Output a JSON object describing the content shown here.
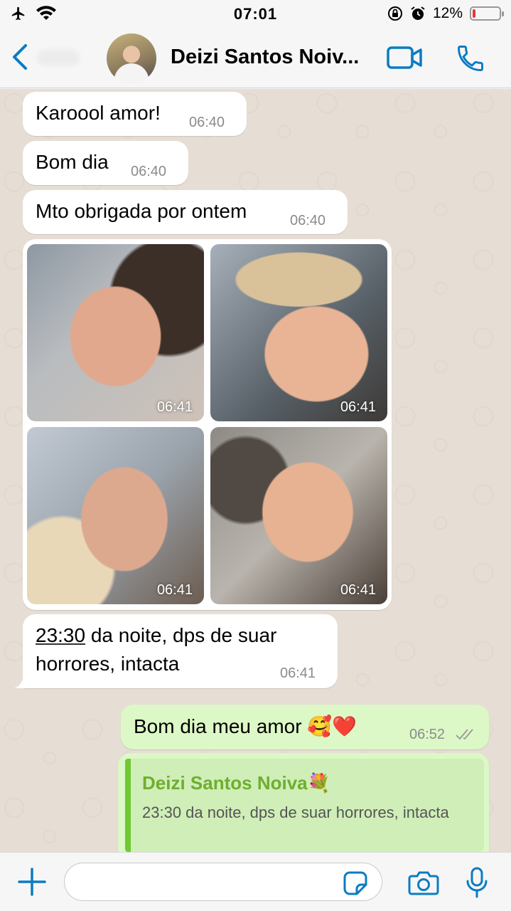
{
  "status_bar": {
    "time": "07:01",
    "battery": "12%",
    "battery_level": 0.12
  },
  "header": {
    "contact_name": "Deizi Santos Noiv..."
  },
  "messages": [
    {
      "text": "Karoool amor!",
      "time": "06:40"
    },
    {
      "text": "Bom dia",
      "time": "06:40"
    },
    {
      "text": "Mto obrigada por ontem",
      "time": "06:40"
    }
  ],
  "photos": [
    {
      "time": "06:41"
    },
    {
      "time": "06:41"
    },
    {
      "time": "06:41"
    },
    {
      "time": "06:41"
    }
  ],
  "long_message": {
    "link": "23:30",
    "line1_rest": " da noite, dps de suar",
    "line2": "horrores, intacta",
    "time": "06:41"
  },
  "outgoing": {
    "text": "Bom dia meu amor 🥰❤️",
    "time": "06:52"
  },
  "quoted": {
    "name": "Deizi Santos Noiva💐",
    "text": "23:30 da noite, dps de suar horrores, intacta"
  },
  "colors": {
    "accent": "#0a7cc2",
    "outgoing_bubble": "#dcf8c6",
    "quote_green": "#6fae2f"
  }
}
